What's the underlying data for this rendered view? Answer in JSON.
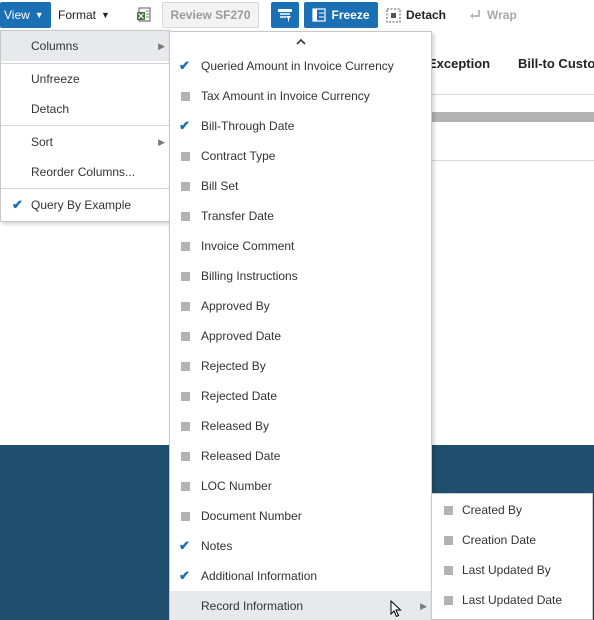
{
  "toolbar": {
    "view_label": "View",
    "format_label": "Format",
    "review_label": "Review SF270",
    "freeze_label": "Freeze",
    "detach_label": "Detach",
    "wrap_label": "Wrap"
  },
  "table_headers": {
    "exception": "Exception",
    "bill_to_customer": "Bill-to Custo"
  },
  "view_menu": {
    "columns": "Columns",
    "unfreeze": "Unfreeze",
    "detach": "Detach",
    "sort": "Sort",
    "reorder_columns": "Reorder Columns...",
    "query_by_example": "Query By Example",
    "query_by_example_checked": true
  },
  "columns_menu": {
    "items": [
      {
        "label": "Queried Amount in Invoice Currency",
        "checked": true
      },
      {
        "label": "Tax Amount in Invoice Currency",
        "checked": false
      },
      {
        "label": "Bill-Through Date",
        "checked": true
      },
      {
        "label": "Contract Type",
        "checked": false
      },
      {
        "label": "Bill Set",
        "checked": false
      },
      {
        "label": "Transfer Date",
        "checked": false
      },
      {
        "label": "Invoice Comment",
        "checked": false
      },
      {
        "label": "Billing Instructions",
        "checked": false
      },
      {
        "label": "Approved By",
        "checked": false
      },
      {
        "label": "Approved Date",
        "checked": false
      },
      {
        "label": "Rejected By",
        "checked": false
      },
      {
        "label": "Rejected Date",
        "checked": false
      },
      {
        "label": "Released By",
        "checked": false
      },
      {
        "label": "Released Date",
        "checked": false
      },
      {
        "label": "LOC Number",
        "checked": false
      },
      {
        "label": "Document Number",
        "checked": false
      },
      {
        "label": "Notes",
        "checked": true
      },
      {
        "label": "Additional Information",
        "checked": true
      },
      {
        "label": "Record Information",
        "submenu": true
      }
    ]
  },
  "record_info_menu": {
    "items": [
      {
        "label": "Created By"
      },
      {
        "label": "Creation Date"
      },
      {
        "label": "Last Updated By"
      },
      {
        "label": "Last Updated Date"
      }
    ]
  },
  "colors": {
    "accent": "#1a6fb5",
    "check": "#1a6fb5",
    "band": "#1f4e6e",
    "hover": "#e7e9ec"
  }
}
